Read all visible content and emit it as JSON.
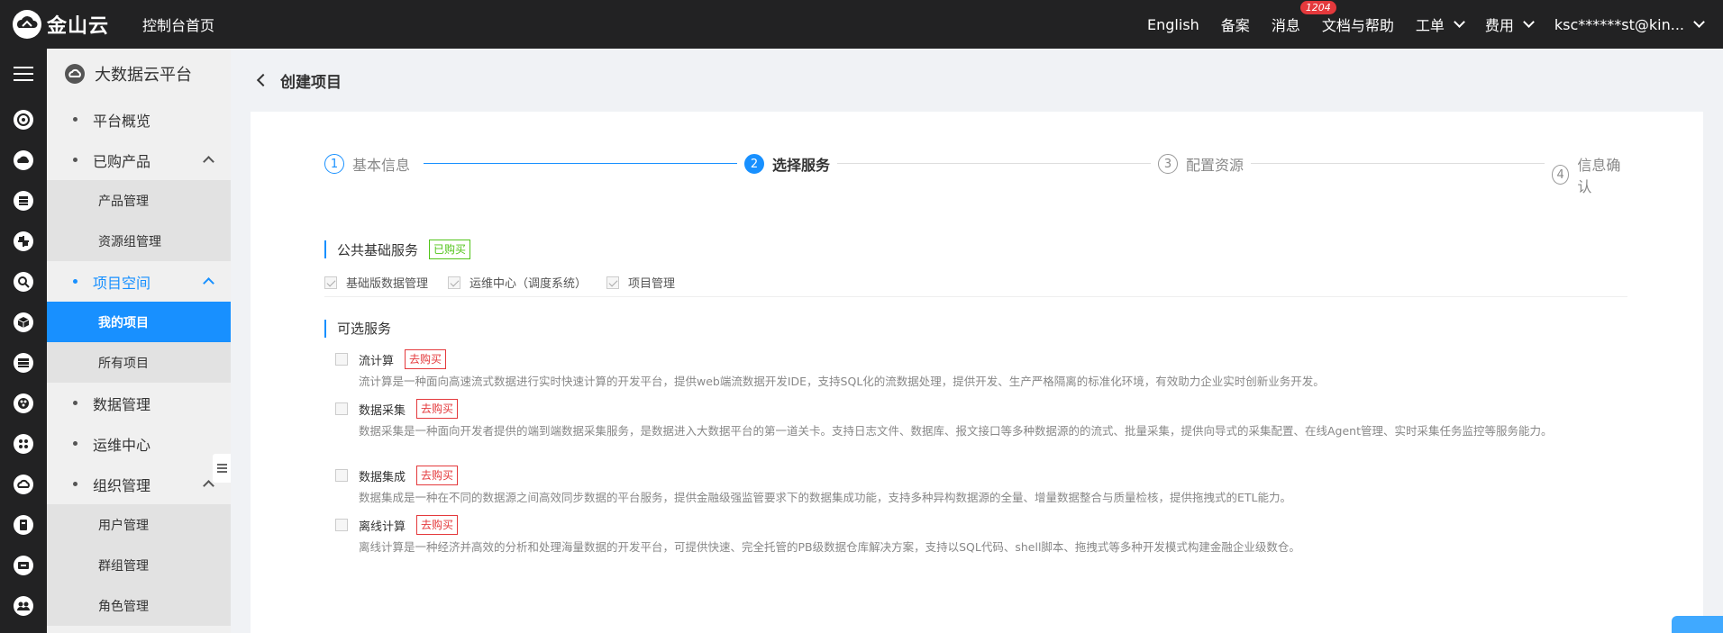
{
  "topbar": {
    "logo_text": "金山云",
    "console_home": "控制台首页",
    "lang": "English",
    "filing": "备案",
    "messages": "消息",
    "messages_badge": "1204",
    "docs": "文档与帮助",
    "tickets": "工单",
    "billing": "费用",
    "account": "ksc******st@kin..."
  },
  "rail": {
    "icons": [
      "menu-icon",
      "dashboard-icon",
      "cloud-icon",
      "database-icon",
      "network-icon",
      "monitor-icon",
      "package-icon",
      "server-icon",
      "palette-icon",
      "cluster-icon",
      "bigdata-icon",
      "storage-icon",
      "transfer-icon",
      "users-icon"
    ]
  },
  "sidebar": {
    "title": "大数据云平台",
    "items": [
      {
        "label": "平台概览"
      },
      {
        "label": "已购产品"
      },
      {
        "label": "产品管理"
      },
      {
        "label": "资源组管理"
      },
      {
        "label": "项目空间"
      },
      {
        "label": "我的项目"
      },
      {
        "label": "所有项目"
      },
      {
        "label": "数据管理"
      },
      {
        "label": "运维中心"
      },
      {
        "label": "组织管理"
      },
      {
        "label": "用户管理"
      },
      {
        "label": "群组管理"
      },
      {
        "label": "角色管理"
      }
    ]
  },
  "page": {
    "title": "创建项目"
  },
  "steps": [
    {
      "num": "1",
      "label": "基本信息",
      "state": "done"
    },
    {
      "num": "2",
      "label": "选择服务",
      "state": "current"
    },
    {
      "num": "3",
      "label": "配置资源",
      "state": "todo"
    },
    {
      "num": "4",
      "label": "信息确认",
      "state": "todo"
    }
  ],
  "public_services": {
    "title": "公共基础服务",
    "tag": "已购买",
    "items": [
      {
        "label": "基础版数据管理",
        "checked": true
      },
      {
        "label": "运维中心（调度系统）",
        "checked": true
      },
      {
        "label": "项目管理",
        "checked": true
      }
    ]
  },
  "optional_services": {
    "title": "可选服务",
    "buy_label": "去购买",
    "items": [
      {
        "name": "流计算",
        "desc": "流计算是一种面向高速流式数据进行实时快速计算的开发平台，提供web端流数据开发IDE，支持SQL化的流数据处理，提供开发、生产严格隔离的标准化环境，有效助力企业实时创新业务开发。"
      },
      {
        "name": "数据采集",
        "desc": "数据采集是一种面向开发者提供的端到端数据采集服务，是数据进入大数据平台的第一道关卡。支持日志文件、数据库、报文接口等多种数据源的的流式、批量采集，提供向导式的采集配置、在线Agent管理、实时采集任务监控等服务能力。"
      },
      {
        "name": "数据集成",
        "desc": "数据集成是一种在不同的数据源之间高效同步数据的平台服务，提供金融级强监管要求下的数据集成功能，支持多种异构数据源的全量、增量数据整合与质量检核，提供拖拽式的ETL能力。"
      },
      {
        "name": "离线计算",
        "desc": "离线计算是一种经济并高效的分析和处理海量数据的开发平台，可提供快速、完全托管的PB级数据仓库解决方案，支持以SQL代码、shell脚本、拖拽式等多种开发模式构建金融企业级数仓。"
      }
    ]
  },
  "colors": {
    "accent": "#1890ff",
    "topbar": "#222223",
    "purchased": "#52c41a",
    "buy": "#e4393c"
  }
}
